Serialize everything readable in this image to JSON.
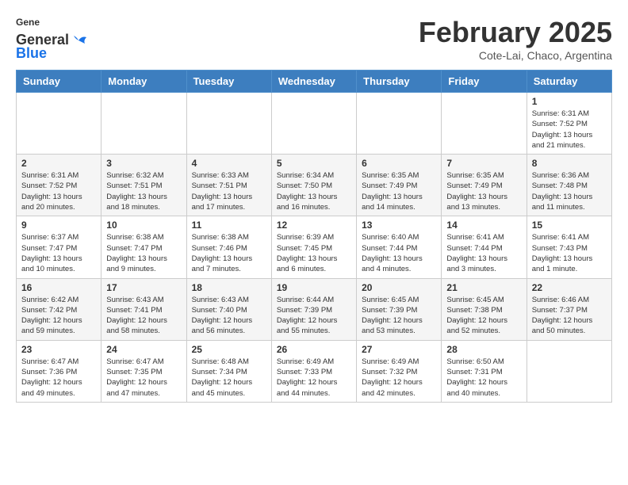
{
  "header": {
    "logo_line1": "General",
    "logo_line2": "Blue",
    "month_title": "February 2025",
    "subtitle": "Cote-Lai, Chaco, Argentina"
  },
  "days_of_week": [
    "Sunday",
    "Monday",
    "Tuesday",
    "Wednesday",
    "Thursday",
    "Friday",
    "Saturday"
  ],
  "weeks": [
    [
      {
        "num": "",
        "info": ""
      },
      {
        "num": "",
        "info": ""
      },
      {
        "num": "",
        "info": ""
      },
      {
        "num": "",
        "info": ""
      },
      {
        "num": "",
        "info": ""
      },
      {
        "num": "",
        "info": ""
      },
      {
        "num": "1",
        "info": "Sunrise: 6:31 AM\nSunset: 7:52 PM\nDaylight: 13 hours\nand 21 minutes."
      }
    ],
    [
      {
        "num": "2",
        "info": "Sunrise: 6:31 AM\nSunset: 7:52 PM\nDaylight: 13 hours\nand 20 minutes."
      },
      {
        "num": "3",
        "info": "Sunrise: 6:32 AM\nSunset: 7:51 PM\nDaylight: 13 hours\nand 18 minutes."
      },
      {
        "num": "4",
        "info": "Sunrise: 6:33 AM\nSunset: 7:51 PM\nDaylight: 13 hours\nand 17 minutes."
      },
      {
        "num": "5",
        "info": "Sunrise: 6:34 AM\nSunset: 7:50 PM\nDaylight: 13 hours\nand 16 minutes."
      },
      {
        "num": "6",
        "info": "Sunrise: 6:35 AM\nSunset: 7:49 PM\nDaylight: 13 hours\nand 14 minutes."
      },
      {
        "num": "7",
        "info": "Sunrise: 6:35 AM\nSunset: 7:49 PM\nDaylight: 13 hours\nand 13 minutes."
      },
      {
        "num": "8",
        "info": "Sunrise: 6:36 AM\nSunset: 7:48 PM\nDaylight: 13 hours\nand 11 minutes."
      }
    ],
    [
      {
        "num": "9",
        "info": "Sunrise: 6:37 AM\nSunset: 7:47 PM\nDaylight: 13 hours\nand 10 minutes."
      },
      {
        "num": "10",
        "info": "Sunrise: 6:38 AM\nSunset: 7:47 PM\nDaylight: 13 hours\nand 9 minutes."
      },
      {
        "num": "11",
        "info": "Sunrise: 6:38 AM\nSunset: 7:46 PM\nDaylight: 13 hours\nand 7 minutes."
      },
      {
        "num": "12",
        "info": "Sunrise: 6:39 AM\nSunset: 7:45 PM\nDaylight: 13 hours\nand 6 minutes."
      },
      {
        "num": "13",
        "info": "Sunrise: 6:40 AM\nSunset: 7:44 PM\nDaylight: 13 hours\nand 4 minutes."
      },
      {
        "num": "14",
        "info": "Sunrise: 6:41 AM\nSunset: 7:44 PM\nDaylight: 13 hours\nand 3 minutes."
      },
      {
        "num": "15",
        "info": "Sunrise: 6:41 AM\nSunset: 7:43 PM\nDaylight: 13 hours\nand 1 minute."
      }
    ],
    [
      {
        "num": "16",
        "info": "Sunrise: 6:42 AM\nSunset: 7:42 PM\nDaylight: 12 hours\nand 59 minutes."
      },
      {
        "num": "17",
        "info": "Sunrise: 6:43 AM\nSunset: 7:41 PM\nDaylight: 12 hours\nand 58 minutes."
      },
      {
        "num": "18",
        "info": "Sunrise: 6:43 AM\nSunset: 7:40 PM\nDaylight: 12 hours\nand 56 minutes."
      },
      {
        "num": "19",
        "info": "Sunrise: 6:44 AM\nSunset: 7:39 PM\nDaylight: 12 hours\nand 55 minutes."
      },
      {
        "num": "20",
        "info": "Sunrise: 6:45 AM\nSunset: 7:39 PM\nDaylight: 12 hours\nand 53 minutes."
      },
      {
        "num": "21",
        "info": "Sunrise: 6:45 AM\nSunset: 7:38 PM\nDaylight: 12 hours\nand 52 minutes."
      },
      {
        "num": "22",
        "info": "Sunrise: 6:46 AM\nSunset: 7:37 PM\nDaylight: 12 hours\nand 50 minutes."
      }
    ],
    [
      {
        "num": "23",
        "info": "Sunrise: 6:47 AM\nSunset: 7:36 PM\nDaylight: 12 hours\nand 49 minutes."
      },
      {
        "num": "24",
        "info": "Sunrise: 6:47 AM\nSunset: 7:35 PM\nDaylight: 12 hours\nand 47 minutes."
      },
      {
        "num": "25",
        "info": "Sunrise: 6:48 AM\nSunset: 7:34 PM\nDaylight: 12 hours\nand 45 minutes."
      },
      {
        "num": "26",
        "info": "Sunrise: 6:49 AM\nSunset: 7:33 PM\nDaylight: 12 hours\nand 44 minutes."
      },
      {
        "num": "27",
        "info": "Sunrise: 6:49 AM\nSunset: 7:32 PM\nDaylight: 12 hours\nand 42 minutes."
      },
      {
        "num": "28",
        "info": "Sunrise: 6:50 AM\nSunset: 7:31 PM\nDaylight: 12 hours\nand 40 minutes."
      },
      {
        "num": "",
        "info": ""
      }
    ]
  ]
}
